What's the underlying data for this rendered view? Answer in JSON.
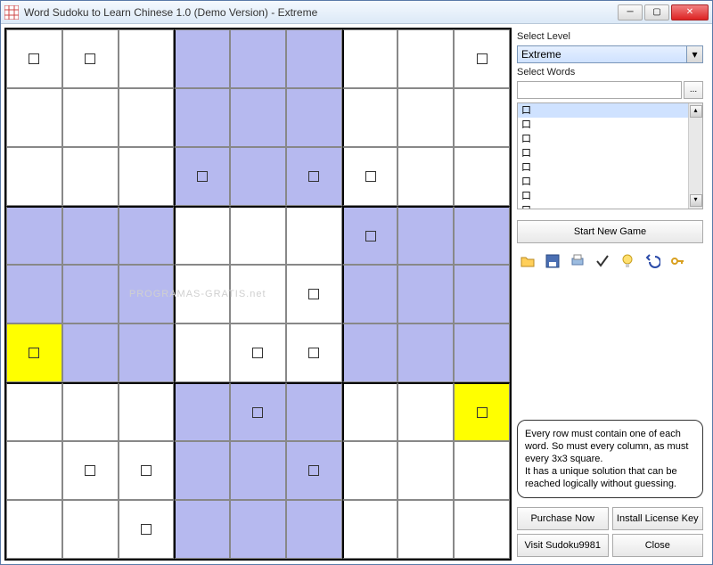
{
  "window": {
    "title": "Word Sudoku to Learn Chinese 1.0 (Demo Version) - Extreme"
  },
  "sidebar": {
    "level_label": "Select Level",
    "level_value": "Extreme",
    "words_label": "Select Words",
    "words_value": "",
    "browse_label": "...",
    "wordlist": [
      "口",
      "口",
      "口",
      "口",
      "口",
      "口",
      "口",
      "口"
    ],
    "start_label": "Start New Game",
    "hint_text": "Every row must contain one of each word. So must every column, as must every 3x3 square.\nIt has a unique solution that can be reached logically without guessing.",
    "buttons": {
      "purchase": "Purchase Now",
      "install": "Install License Key",
      "visit": "Visit Sudoku9981",
      "close": "Close"
    }
  },
  "grid": [
    [
      {
        "c": "",
        "g": 1
      },
      {
        "c": "",
        "g": 1
      },
      {
        "c": "",
        "g": 0
      },
      {
        "c": "b",
        "g": 0
      },
      {
        "c": "b",
        "g": 0
      },
      {
        "c": "b",
        "g": 0
      },
      {
        "c": "",
        "g": 0
      },
      {
        "c": "",
        "g": 0
      },
      {
        "c": "",
        "g": 1
      }
    ],
    [
      {
        "c": "",
        "g": 0
      },
      {
        "c": "",
        "g": 0
      },
      {
        "c": "",
        "g": 0
      },
      {
        "c": "b",
        "g": 0
      },
      {
        "c": "b",
        "g": 0
      },
      {
        "c": "b",
        "g": 0
      },
      {
        "c": "",
        "g": 0
      },
      {
        "c": "",
        "g": 0
      },
      {
        "c": "",
        "g": 0
      }
    ],
    [
      {
        "c": "",
        "g": 0
      },
      {
        "c": "",
        "g": 0
      },
      {
        "c": "",
        "g": 0
      },
      {
        "c": "b",
        "g": 1
      },
      {
        "c": "b",
        "g": 0
      },
      {
        "c": "b",
        "g": 1
      },
      {
        "c": "",
        "g": 1
      },
      {
        "c": "",
        "g": 0
      },
      {
        "c": "",
        "g": 0
      }
    ],
    [
      {
        "c": "b",
        "g": 0
      },
      {
        "c": "b",
        "g": 0
      },
      {
        "c": "b",
        "g": 0
      },
      {
        "c": "",
        "g": 0
      },
      {
        "c": "",
        "g": 0
      },
      {
        "c": "",
        "g": 0
      },
      {
        "c": "b",
        "g": 1
      },
      {
        "c": "b",
        "g": 0
      },
      {
        "c": "b",
        "g": 0
      }
    ],
    [
      {
        "c": "b",
        "g": 0
      },
      {
        "c": "b",
        "g": 0
      },
      {
        "c": "b",
        "g": 0
      },
      {
        "c": "",
        "g": 0
      },
      {
        "c": "",
        "g": 0
      },
      {
        "c": "",
        "g": 1
      },
      {
        "c": "b",
        "g": 0
      },
      {
        "c": "b",
        "g": 0
      },
      {
        "c": "b",
        "g": 0
      }
    ],
    [
      {
        "c": "y",
        "g": 1
      },
      {
        "c": "b",
        "g": 0
      },
      {
        "c": "b",
        "g": 0
      },
      {
        "c": "",
        "g": 0
      },
      {
        "c": "",
        "g": 1
      },
      {
        "c": "",
        "g": 1
      },
      {
        "c": "b",
        "g": 0
      },
      {
        "c": "b",
        "g": 0
      },
      {
        "c": "b",
        "g": 0
      }
    ],
    [
      {
        "c": "",
        "g": 0
      },
      {
        "c": "",
        "g": 0
      },
      {
        "c": "",
        "g": 0
      },
      {
        "c": "b",
        "g": 0
      },
      {
        "c": "b",
        "g": 1
      },
      {
        "c": "b",
        "g": 0
      },
      {
        "c": "",
        "g": 0
      },
      {
        "c": "",
        "g": 0
      },
      {
        "c": "y",
        "g": 1
      }
    ],
    [
      {
        "c": "",
        "g": 0
      },
      {
        "c": "",
        "g": 1
      },
      {
        "c": "",
        "g": 1
      },
      {
        "c": "b",
        "g": 0
      },
      {
        "c": "b",
        "g": 0
      },
      {
        "c": "b",
        "g": 1
      },
      {
        "c": "",
        "g": 0
      },
      {
        "c": "",
        "g": 0
      },
      {
        "c": "",
        "g": 0
      }
    ],
    [
      {
        "c": "",
        "g": 0
      },
      {
        "c": "",
        "g": 0
      },
      {
        "c": "",
        "g": 1
      },
      {
        "c": "b",
        "g": 0
      },
      {
        "c": "b",
        "g": 0
      },
      {
        "c": "b",
        "g": 0
      },
      {
        "c": "",
        "g": 0
      },
      {
        "c": "",
        "g": 0
      },
      {
        "c": "",
        "g": 0
      }
    ]
  ],
  "watermark": "PROGRAMAS-GRATIS.net"
}
